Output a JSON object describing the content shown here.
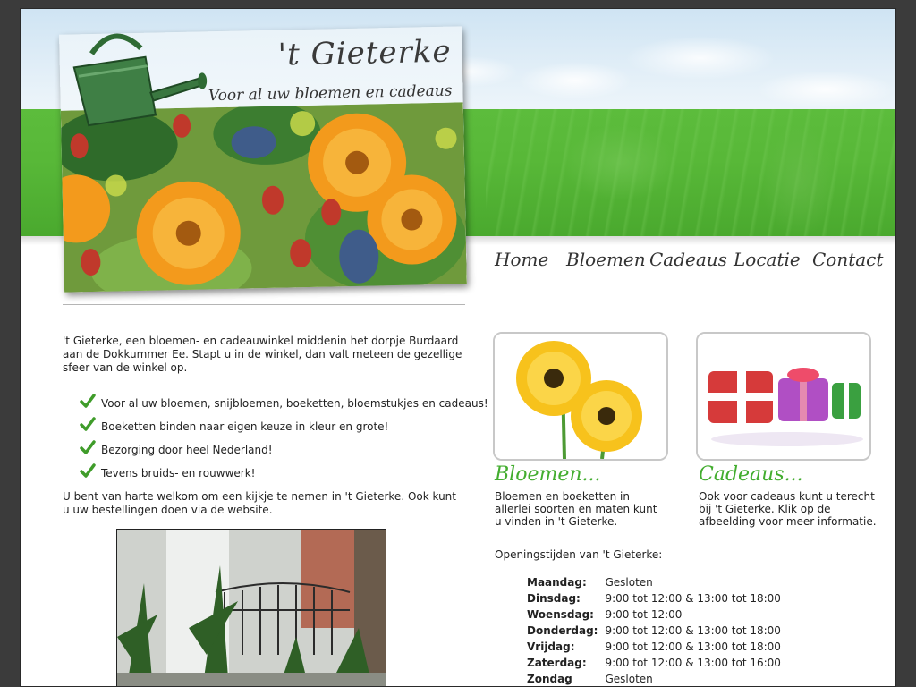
{
  "site": {
    "title": "'t Gieterke",
    "tagline": "Voor al uw bloemen en cadeaus"
  },
  "nav": [
    {
      "label": "Home"
    },
    {
      "label": "Bloemen"
    },
    {
      "label": "Cadeaus"
    },
    {
      "label": "Locatie"
    },
    {
      "label": "Contact"
    }
  ],
  "main": {
    "intro": "'t Gieterke, een bloemen- en cadeauwinkel middenin het dorpje Burdaard aan de Dokkummer Ee. Stapt u in de winkel, dan valt meteen de gezellige sfeer van de winkel op.",
    "checklist": [
      "Voor al uw bloemen, snijbloemen, boeketten, bloemstukjes en cadeaus!",
      "Boeketten binden naar eigen keuze in kleur en grote!",
      "Bezorging door heel Nederland!",
      "Tevens bruids- en rouwwerk!"
    ],
    "welcome": "U bent van harte welkom om een kijkje te nemen in 't Gieterke. Ook kunt u uw bestellingen doen via de website."
  },
  "promos": {
    "bloemen": {
      "heading": "Bloemen...",
      "text": "Bloemen en boeketten in allerlei soorten en maten kunt u vinden in 't Gieterke."
    },
    "cadeaus": {
      "heading": "Cadeaus...",
      "text": "Ook voor cadeaus kunt u terecht bij 't Gieterke. Klik op de afbeelding voor meer informatie."
    }
  },
  "hours": {
    "title": "Openingstijden van 't Gieterke:",
    "rows": [
      {
        "day": "Maandag:",
        "time": "Gesloten"
      },
      {
        "day": "Dinsdag:",
        "time": "9:00 tot 12:00 & 13:00 tot 18:00"
      },
      {
        "day": "Woensdag:",
        "time": "9:00 tot 12:00"
      },
      {
        "day": "Donderdag:",
        "time": "9:00 tot 12:00 & 13:00 tot 18:00"
      },
      {
        "day": "Vrijdag:",
        "time": "9:00 tot 12:00 & 13:00 tot 18:00"
      },
      {
        "day": "Zaterdag:",
        "time": "9:00 tot 12:00 & 13:00 tot 16:00"
      },
      {
        "day": "Zondag",
        "time": "Gesloten"
      }
    ]
  },
  "icons": {
    "check": "check-icon",
    "logo": "watering-can-icon"
  },
  "colors": {
    "accent_green": "#43ad2f",
    "header_green": "#58b838",
    "page_bg": "#3b3b3b",
    "check_green": "#3f9c2a"
  }
}
